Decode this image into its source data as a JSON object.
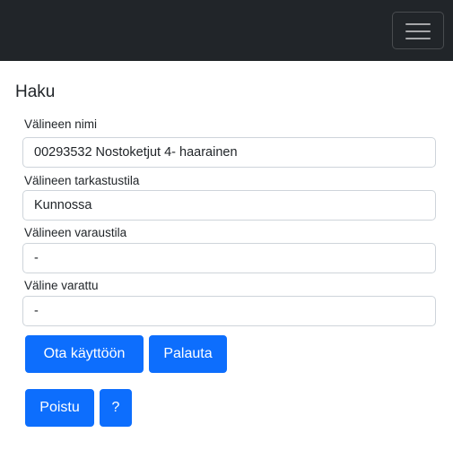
{
  "navbar": {
    "toggler_icon": "hamburger-menu-icon"
  },
  "page": {
    "heading": "Haku"
  },
  "form": {
    "name_label": "Välineen nimi",
    "name_value": "00293532 Nostoketjut 4- haarainen",
    "inspection_label": "Välineen tarkastustila",
    "inspection_value": "Kunnossa",
    "reservation_label": "Välineen varaustila",
    "reservation_value": "-",
    "reserved_label": "Väline varattu",
    "reserved_value": "-"
  },
  "buttons": {
    "take_into_use": "Ota käyttöön",
    "return": "Palauta",
    "exit": "Poistu",
    "help": "?"
  },
  "colors": {
    "navbar_bg": "#212529",
    "primary": "#0d6efd"
  }
}
